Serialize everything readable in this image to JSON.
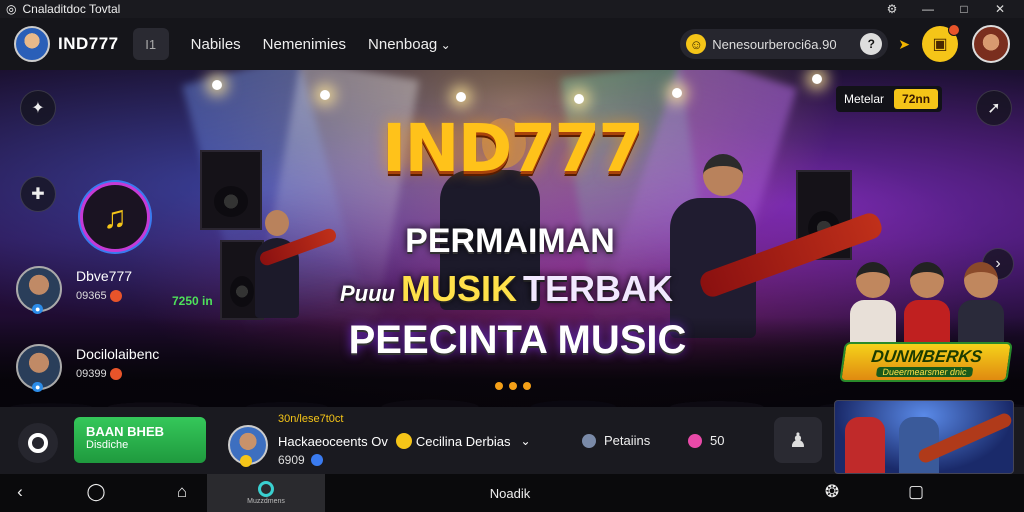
{
  "window": {
    "title": "Cnaladitdoc Tovtal",
    "logo_icon": "app-logo-icon",
    "controls": [
      "minimize",
      "maximize",
      "close"
    ]
  },
  "topnav": {
    "brand": "IND777",
    "menu_label": "I1",
    "links": [
      "Nabiles",
      "Nemenimies",
      "Nnenboag"
    ],
    "search_text": "Nenesourberoci6a.90",
    "search_emoji_icon": "smiley-icon",
    "help_label": "?",
    "pin_icon": "pin-icon",
    "gift_icon": "gift-icon"
  },
  "hero": {
    "title": "IND777",
    "line1": "PERMAIMAN",
    "line2_a": "Puuu",
    "line2_b": "MUSIK",
    "line2_c": "TERBAK",
    "line3": "PEECINTA MUSIC",
    "tag_label": "Metelar",
    "tag_value": "72nn",
    "music_icon": "music-note-icon",
    "players": [
      {
        "name": "Dbve777",
        "stat": "09365"
      },
      {
        "name": "Docilolaibenc",
        "stat": "09399"
      }
    ],
    "green_stat": "7250 in",
    "band_logo_title": "DUNMBERKS",
    "band_logo_sub": "Dueermearsmer dnic"
  },
  "bottombar": {
    "cta_line1": "BAAN BHEB",
    "cta_line2": "Disdiche",
    "now_top": "30n/lese7t0ct",
    "now_name": "Hackaeoceents Ov",
    "now_extra": "Cecilina Derbias",
    "now_sub": "6909",
    "stat1_label": "Petaiins",
    "stat2_label": "50",
    "colors": {
      "green": "#2fb64f",
      "gold": "#f5c518",
      "accent": "#c53ad6"
    }
  },
  "sysnav": {
    "active_label": "Muzzdmens",
    "center_label": "Noadik"
  }
}
